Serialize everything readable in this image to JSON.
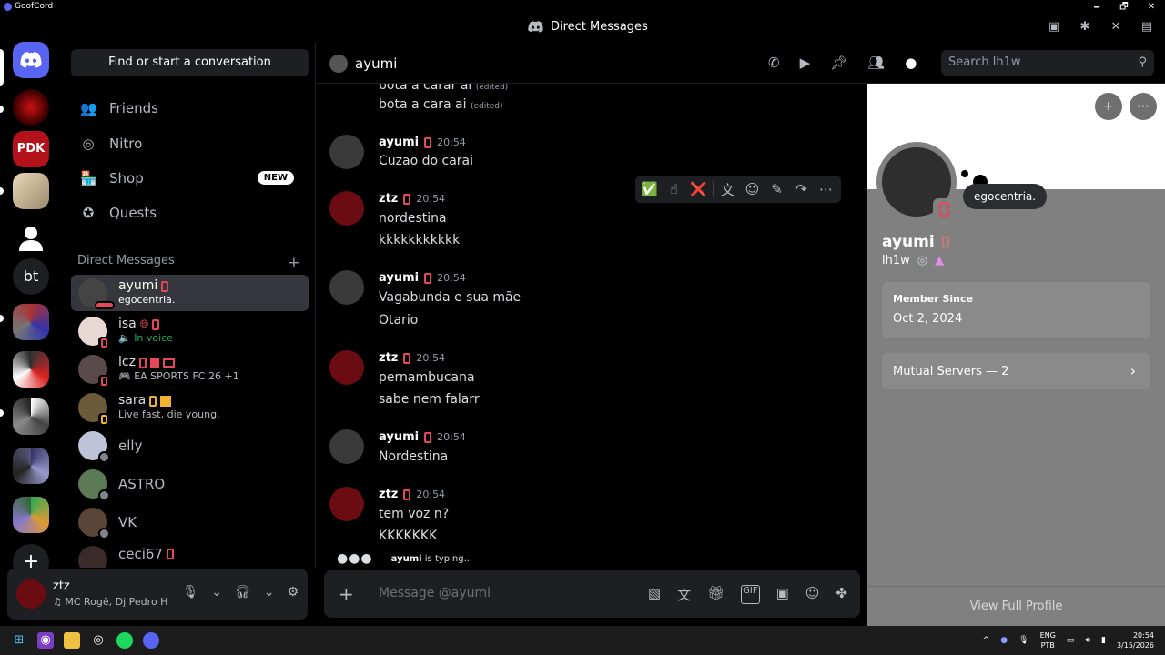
{
  "window": {
    "app_name": "GoofCord",
    "title": "Direct Messages",
    "min": "🗕",
    "max": "🗗",
    "close": "✕"
  },
  "sidebar": {
    "search_label": "Find or start a conversation",
    "nav": [
      {
        "label": "Friends",
        "icon": "friends-icon",
        "glyph": "👥"
      },
      {
        "label": "Nitro",
        "icon": "nitro-icon",
        "glyph": "◎"
      },
      {
        "label": "Shop",
        "icon": "shop-icon",
        "glyph": "🏪",
        "badge": "NEW"
      },
      {
        "label": "Quests",
        "icon": "quests-icon",
        "glyph": "✪"
      }
    ],
    "dm_header": "Direct Messages",
    "dm_add": "+",
    "dms": [
      {
        "name": "ayumi",
        "status": "egocentria."
      },
      {
        "name": "isa",
        "status": "🔈 In voice"
      },
      {
        "name": "lcz",
        "status": "🎮 EA SPORTS FC 26 +1"
      },
      {
        "name": "sara",
        "status": "Live fast, die young."
      },
      {
        "name": "elly"
      },
      {
        "name": "ASTRO"
      },
      {
        "name": "VK"
      },
      {
        "name": "ceci67"
      }
    ]
  },
  "user_panel": {
    "username": "ztz",
    "activity": "♫ MC Rogê, Dj Pedro H"
  },
  "chat": {
    "recipient": "ayumi",
    "search_placeholder": "Search lh1w",
    "messages": [
      {
        "lines": [
          "bota a carar ai",
          "bota a cara ai"
        ],
        "edited": "(edited)"
      },
      {
        "author": "ayumi",
        "time": "20:54",
        "lines": [
          "Cuzao do carai"
        ]
      },
      {
        "author": "ztz",
        "time": "20:54",
        "lines": [
          "nordestina",
          "kkkkkkkkkkk"
        ]
      },
      {
        "author": "ayumi",
        "time": "20:54",
        "lines": [
          "Vagabunda e sua mãe",
          "Otario"
        ]
      },
      {
        "author": "ztz",
        "time": "20:54",
        "lines": [
          "pernambucana",
          "sabe nem falarr"
        ]
      },
      {
        "author": "ayumi",
        "time": "20:54",
        "lines": [
          "Nordestina"
        ]
      },
      {
        "author": "ztz",
        "time": "20:54",
        "lines": [
          "tem voz n?",
          "KKKKKKK"
        ]
      }
    ],
    "hover_actions": {
      "react1": "✅",
      "react2": "☝",
      "react3": "❌"
    },
    "typing_user": "ayumi",
    "typing_text": " is typing...",
    "composer_placeholder": "Message @ayumi"
  },
  "profile": {
    "name": "ayumi",
    "username": "lh1w",
    "custom_status": "egocentria.",
    "member_since_label": "Member Since",
    "member_since": "Oct 2, 2024",
    "mutual_servers": "Mutual Servers — 2",
    "view_full": "View Full Profile"
  },
  "taskbar": {
    "lang": "ENG",
    "layout": "PTB",
    "time": "20:54",
    "date": "3/15/2026"
  },
  "colors": {
    "accent": "#5865f2",
    "dnd_red": "#e8465a",
    "new_badge": "#ffffff"
  }
}
